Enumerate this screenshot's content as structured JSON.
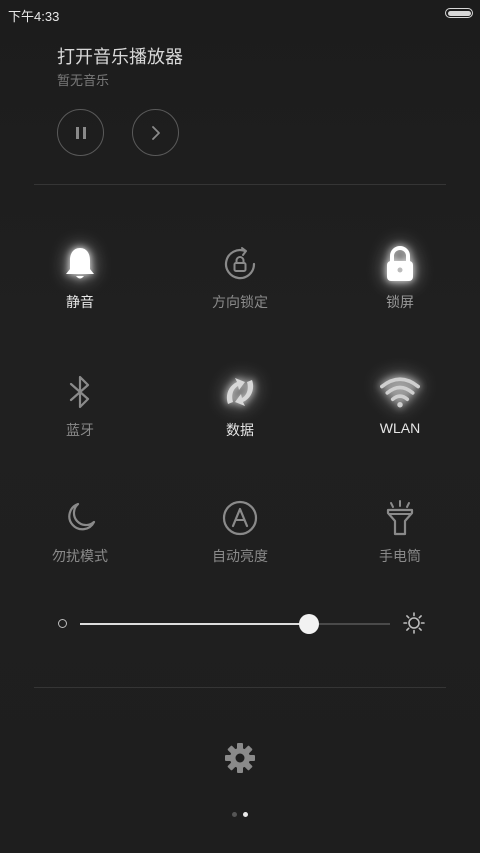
{
  "status_bar": {
    "time": "下午4:33"
  },
  "music": {
    "title": "打开音乐播放器",
    "subtitle": "暂无音乐"
  },
  "toggles": [
    {
      "label": "静音",
      "icon": "bell-icon",
      "on": true
    },
    {
      "label": "方向锁定",
      "icon": "rotation-lock-icon",
      "on": false
    },
    {
      "label": "锁屏",
      "icon": "lock-icon",
      "on": true
    },
    {
      "label": "蓝牙",
      "icon": "bluetooth-icon",
      "on": false
    },
    {
      "label": "数据",
      "icon": "data-sync-icon",
      "on": true
    },
    {
      "label": "WLAN",
      "icon": "wifi-icon",
      "on": true
    },
    {
      "label": "勿扰模式",
      "icon": "moon-icon",
      "on": false
    },
    {
      "label": "自动亮度",
      "icon": "auto-brightness-icon",
      "on": false
    },
    {
      "label": "手电筒",
      "icon": "flashlight-icon",
      "on": false
    }
  ],
  "brightness": {
    "level": 0.74
  },
  "pager": {
    "pages": 2,
    "current": 2
  }
}
